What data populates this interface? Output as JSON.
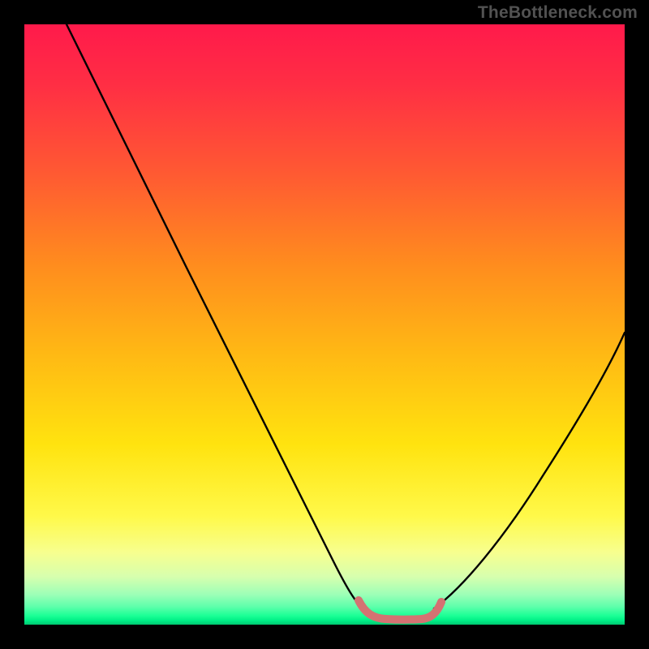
{
  "watermark": "TheBottleneck.com",
  "chart_data": {
    "type": "line",
    "title": "",
    "xlabel": "",
    "ylabel": "",
    "x_range": [
      0,
      100
    ],
    "y_range": [
      0,
      100
    ],
    "series": [
      {
        "name": "black-curve-left",
        "color": "#000000",
        "x": [
          7,
          12,
          18,
          24,
          30,
          36,
          42,
          48,
          52,
          55,
          57
        ],
        "y": [
          100,
          90,
          78,
          66,
          53,
          40,
          28,
          16,
          9,
          5,
          3.5
        ]
      },
      {
        "name": "black-curve-right",
        "color": "#000000",
        "x": [
          68,
          72,
          78,
          84,
          90,
          96,
          100
        ],
        "y": [
          3.5,
          6,
          13,
          22,
          32,
          43,
          51
        ]
      },
      {
        "name": "pink-bottom-segment",
        "color": "#d47272",
        "x": [
          55,
          57,
          59,
          61,
          63,
          65,
          67,
          69
        ],
        "y": [
          4.5,
          2.8,
          2.2,
          2.0,
          2.0,
          2.2,
          2.8,
          4.5
        ]
      }
    ],
    "gradient_stops": [
      {
        "pos": 0,
        "color": "#ff1a4b"
      },
      {
        "pos": 0.55,
        "color": "#ffe30f"
      },
      {
        "pos": 0.92,
        "color": "#d7ffae"
      },
      {
        "pos": 1.0,
        "color": "#00c871"
      }
    ]
  }
}
